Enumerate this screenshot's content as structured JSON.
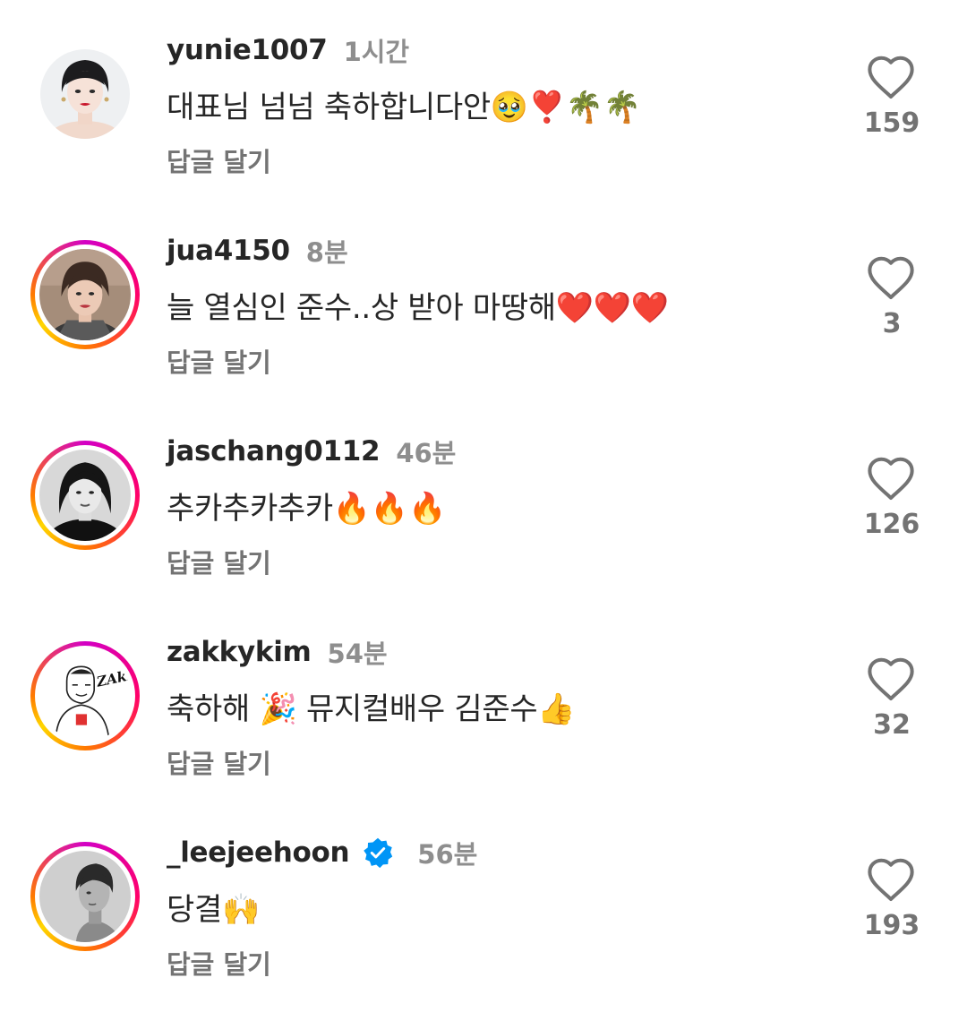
{
  "comments": [
    {
      "username": "yunie1007",
      "time": "1시간",
      "text": "대표님 넘넘 축하합니다안🥹❣️🌴🌴",
      "reply": "답글 달기",
      "likes": "159",
      "ring": false,
      "verified": false,
      "avatar": "avatar"
    },
    {
      "username": "jua4150",
      "time": "8분",
      "text": "늘 열심인 준수..상 받아 마땅해❤️❤️❤️",
      "reply": "답글 달기",
      "likes": "3",
      "ring": true,
      "verified": false,
      "avatar": "avatar"
    },
    {
      "username": "jaschang0112",
      "time": "46분",
      "text": "추카추카추카🔥🔥🔥",
      "reply": "답글 달기",
      "likes": "126",
      "ring": true,
      "verified": false,
      "avatar": "avatar"
    },
    {
      "username": "zakkykim",
      "time": "54분",
      "text": "축하해 🎉 뮤지컬배우 김준수👍",
      "reply": "답글 달기",
      "likes": "32",
      "ring": true,
      "verified": false,
      "avatar": "avatar"
    },
    {
      "username": "_leejeehoon",
      "time": "56분",
      "text": "당결🙌",
      "reply": "답글 달기",
      "likes": "193",
      "ring": true,
      "verified": true,
      "avatar": "avatar"
    }
  ],
  "avatar_logo_text": "ZAkky",
  "colors": {
    "verified": "#0095f6",
    "muted": "#8e8e8e",
    "text": "#262626"
  }
}
